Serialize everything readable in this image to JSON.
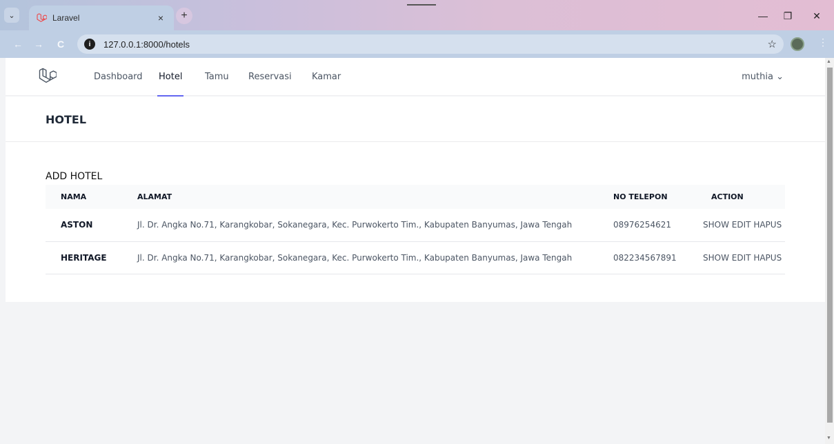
{
  "browser": {
    "tab_title": "Laravel",
    "tab_close": "×",
    "new_tab": "+",
    "tab_list": "⌄",
    "url": "127.0.0.1:8000/hotels",
    "window_minimize": "—",
    "window_restore": "❐",
    "window_close": "✕",
    "back": "←",
    "forward": "→",
    "reload": "C",
    "bookmark": "☆",
    "menu": "⋮"
  },
  "nav": {
    "links": [
      "Dashboard",
      "Hotel",
      "Tamu",
      "Reservasi",
      "Kamar"
    ],
    "active": "Hotel",
    "user": "muthia",
    "user_caret": "⌄"
  },
  "header": {
    "title": "HOTEL"
  },
  "content": {
    "add_label": "ADD HOTEL",
    "columns": [
      "NAMA",
      "ALAMAT",
      "NO TELEPON",
      "ACTION"
    ],
    "rows": [
      {
        "nama": "ASTON",
        "alamat": "Jl. Dr. Angka No.71, Karangkobar, Sokanegara, Kec. Purwokerto Tim., Kabupaten Banyumas, Jawa Tengah",
        "telepon": "08976254621"
      },
      {
        "nama": "HERITAGE",
        "alamat": "Jl. Dr. Angka No.71, Karangkobar, Sokanegara, Kec. Purwokerto Tim., Kabupaten Banyumas, Jawa Tengah",
        "telepon": "082234567891"
      }
    ],
    "actions": {
      "show": "SHOW",
      "edit": "EDIT",
      "hapus": "HAPUS"
    }
  },
  "colors": {
    "accent": "#6366f1",
    "laravel_logo": "#ef4444"
  }
}
